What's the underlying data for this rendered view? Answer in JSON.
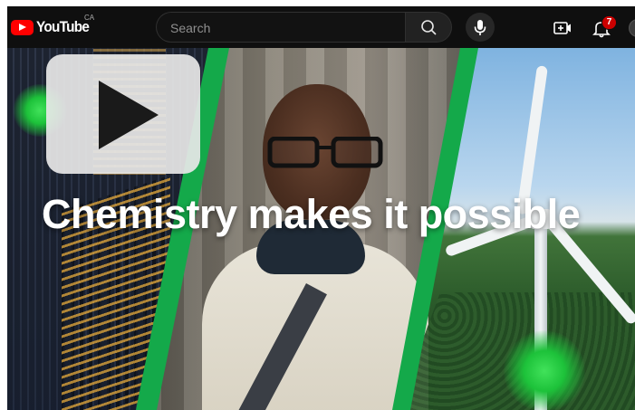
{
  "header": {
    "logo_text": "YouTube",
    "country_code": "CA",
    "search_placeholder": "Search",
    "notification_count": "7",
    "icons": {
      "search": "search-icon",
      "mic": "microphone-icon",
      "create": "create-video-icon",
      "bell": "notifications-bell-icon",
      "avatar": "account-avatar"
    },
    "brand_color": "#ff0000"
  },
  "video": {
    "headline": "Chemistry makes it possible",
    "accent_color": "#14a94a",
    "play_icon": "play-icon"
  }
}
